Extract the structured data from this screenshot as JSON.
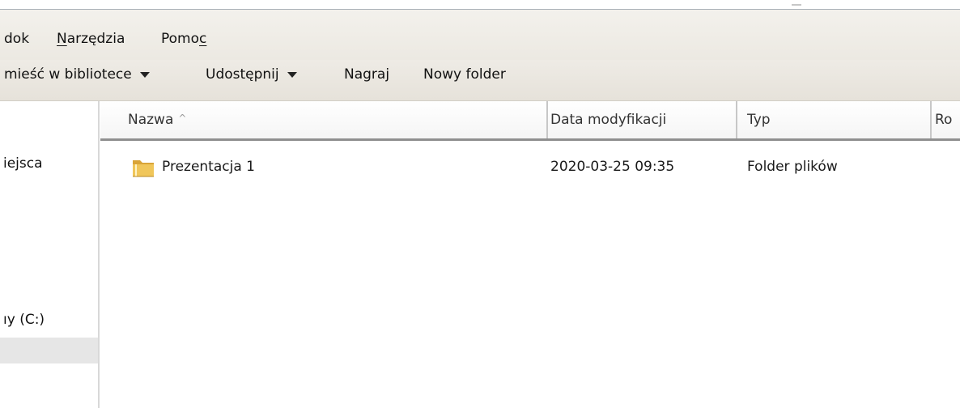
{
  "menu": {
    "items": [
      {
        "name": "menu-widok",
        "pre": "",
        "ul": "",
        "post": "dok"
      },
      {
        "name": "menu-narzedzia",
        "pre": "",
        "ul": "N",
        "post": "arzędzia"
      },
      {
        "name": "menu-pomoc",
        "pre": "Pomo",
        "ul": "c",
        "post": ""
      }
    ]
  },
  "toolbar": {
    "library_label": "mieść w bibliotece",
    "share_label": "Udostępnij",
    "burn_label": "Nagraj",
    "new_folder_label": "Nowy folder"
  },
  "nav": {
    "places_label": "iejsca",
    "drive_label": "ıy (C:)"
  },
  "table": {
    "columns": {
      "name": "Nazwa",
      "sort_indicator": "^",
      "date": "Data modyfikacji",
      "type": "Typ",
      "size": "Ro"
    },
    "rows": [
      {
        "name": "Prezentacja 1",
        "date": "2020-03-25 09:35",
        "type": "Folder plików"
      }
    ]
  },
  "colors": {
    "menubar_bg": "#ece9e2",
    "folder_yellow": "#e8b84a",
    "header_border": "#8f8f8f"
  },
  "icons": [
    "folder-icon",
    "caret-down-icon",
    "sort-ascending-icon"
  ]
}
